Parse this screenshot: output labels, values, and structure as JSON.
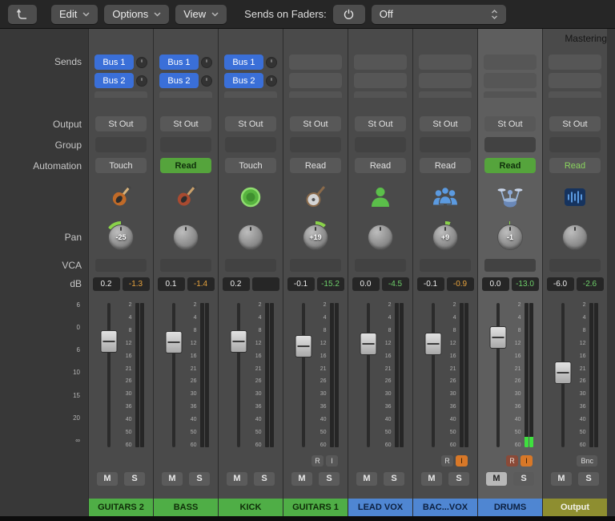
{
  "toolbar": {
    "menus": [
      {
        "label": "Edit"
      },
      {
        "label": "Options"
      },
      {
        "label": "View"
      }
    ],
    "sends_on_faders_label": "Sends on Faders:",
    "sends_on_faders_value": "Off"
  },
  "masthead": {
    "right_track_label": "Mastering"
  },
  "row_labels": {
    "sends": "Sends",
    "output": "Output",
    "group": "Group",
    "automation": "Automation",
    "pan": "Pan",
    "vca": "VCA",
    "db": "dB"
  },
  "strip_labels": {
    "mute": "M",
    "solo": "S",
    "record": "R",
    "input": "I",
    "bounce": "Bnc"
  },
  "fader_scale": [
    "6",
    "0",
    "6",
    "10",
    "15",
    "20",
    "∞"
  ],
  "meter_scale": [
    "2",
    "4",
    "8",
    "12",
    "16",
    "21",
    "26",
    "30",
    "36",
    "40",
    "50",
    "60"
  ],
  "colors": {
    "send_blue": "#3a6fd8",
    "automation_green": "#55a43c",
    "value_orange": "#e8a33d",
    "value_green": "#6ed06a",
    "meter_green": "#3fe03f",
    "name_green": "#4fae46",
    "name_blue": "#4f86d2",
    "name_olive": "#8e8e30"
  },
  "channels": [
    {
      "name": "GUITARS 2",
      "name_color": "green",
      "sends": [
        "Bus 1",
        "Bus 2"
      ],
      "output": "St Out",
      "automation": "Touch",
      "automation_style": "plain",
      "icon": "electric-guitar-icon",
      "pan_value": "-25",
      "pan_arc_deg": -53,
      "db_left": "0.2",
      "db_right": "-1.3",
      "db_right_color": "orange",
      "fader_pos": 0.23,
      "meter_level": 0,
      "has_record": false,
      "record_active": false,
      "has_input": false,
      "input_active": false,
      "has_bounce": false,
      "mute_active": false,
      "selected": false
    },
    {
      "name": "BASS",
      "name_color": "green",
      "sends": [
        "Bus 1",
        "Bus 2"
      ],
      "output": "St Out",
      "automation": "Read",
      "automation_style": "green",
      "icon": "bass-guitar-icon",
      "pan_value": "",
      "pan_arc_deg": 0,
      "db_left": "0.1",
      "db_right": "-1.4",
      "db_right_color": "orange",
      "fader_pos": 0.24,
      "meter_level": 0,
      "has_record": false,
      "record_active": false,
      "has_input": false,
      "input_active": false,
      "has_bounce": false,
      "mute_active": false,
      "selected": false
    },
    {
      "name": "KICK",
      "name_color": "green",
      "sends": [
        "Bus 1",
        "Bus 2"
      ],
      "output": "St Out",
      "automation": "Touch",
      "automation_style": "plain",
      "icon": "kick-drum-icon",
      "pan_value": "",
      "pan_arc_deg": 0,
      "db_left": "0.2",
      "db_right": "",
      "db_right_color": "none",
      "fader_pos": 0.23,
      "meter_level": 0,
      "has_record": false,
      "record_active": false,
      "has_input": false,
      "input_active": false,
      "has_bounce": false,
      "mute_active": false,
      "selected": false
    },
    {
      "name": "GUITARS 1",
      "name_color": "green",
      "sends": [],
      "output": "St Out",
      "automation": "Read",
      "automation_style": "plain",
      "icon": "banjo-icon",
      "pan_value": "+19",
      "pan_arc_deg": 40,
      "db_left": "-0.1",
      "db_right": "-15.2",
      "db_right_color": "green",
      "fader_pos": 0.27,
      "meter_level": 0,
      "has_record": true,
      "record_active": false,
      "has_input": true,
      "input_active": false,
      "has_bounce": false,
      "mute_active": false,
      "selected": false
    },
    {
      "name": "LEAD VOX",
      "name_color": "blue",
      "sends": [],
      "output": "St Out",
      "automation": "Read",
      "automation_style": "plain",
      "icon": "vocalist-icon",
      "pan_value": "",
      "pan_arc_deg": 0,
      "db_left": "0.0",
      "db_right": "-4.5",
      "db_right_color": "green",
      "fader_pos": 0.25,
      "meter_level": 0,
      "has_record": false,
      "record_active": false,
      "has_input": false,
      "input_active": false,
      "has_bounce": false,
      "mute_active": false,
      "selected": false
    },
    {
      "name": "BAC...VOX",
      "name_color": "blue",
      "sends": [],
      "output": "St Out",
      "automation": "Read",
      "automation_style": "plain",
      "icon": "vocal-group-icon",
      "pan_value": "+9",
      "pan_arc_deg": 19,
      "db_left": "-0.1",
      "db_right": "-0.9",
      "db_right_color": "orange",
      "fader_pos": 0.25,
      "meter_level": 0,
      "has_record": true,
      "record_active": false,
      "has_input": true,
      "input_active": true,
      "has_bounce": false,
      "mute_active": false,
      "selected": false
    },
    {
      "name": "DRUMS",
      "name_color": "blue",
      "sends": [],
      "output": "St Out",
      "automation": "Read",
      "automation_style": "green",
      "icon": "drum-kit-icon",
      "pan_value": "-1",
      "pan_arc_deg": -3,
      "db_left": "0.0",
      "db_right": "-13.0",
      "db_right_color": "green",
      "fader_pos": 0.2,
      "meter_level": 0.07,
      "has_record": true,
      "record_active": true,
      "has_input": true,
      "input_active": true,
      "has_bounce": false,
      "mute_active": true,
      "selected": true
    },
    {
      "name": "Output",
      "name_color": "olive",
      "sends": [],
      "output": "St Out",
      "automation": "Read",
      "automation_style": "green-text",
      "icon": "audio-waveform-icon",
      "pan_value": "",
      "pan_arc_deg": 0,
      "db_left": "-6.0",
      "db_right": "-2.6",
      "db_right_color": "green",
      "fader_pos": 0.48,
      "meter_level": 0,
      "has_record": false,
      "record_active": false,
      "has_input": false,
      "input_active": false,
      "has_bounce": true,
      "mute_active": false,
      "selected": false
    }
  ]
}
